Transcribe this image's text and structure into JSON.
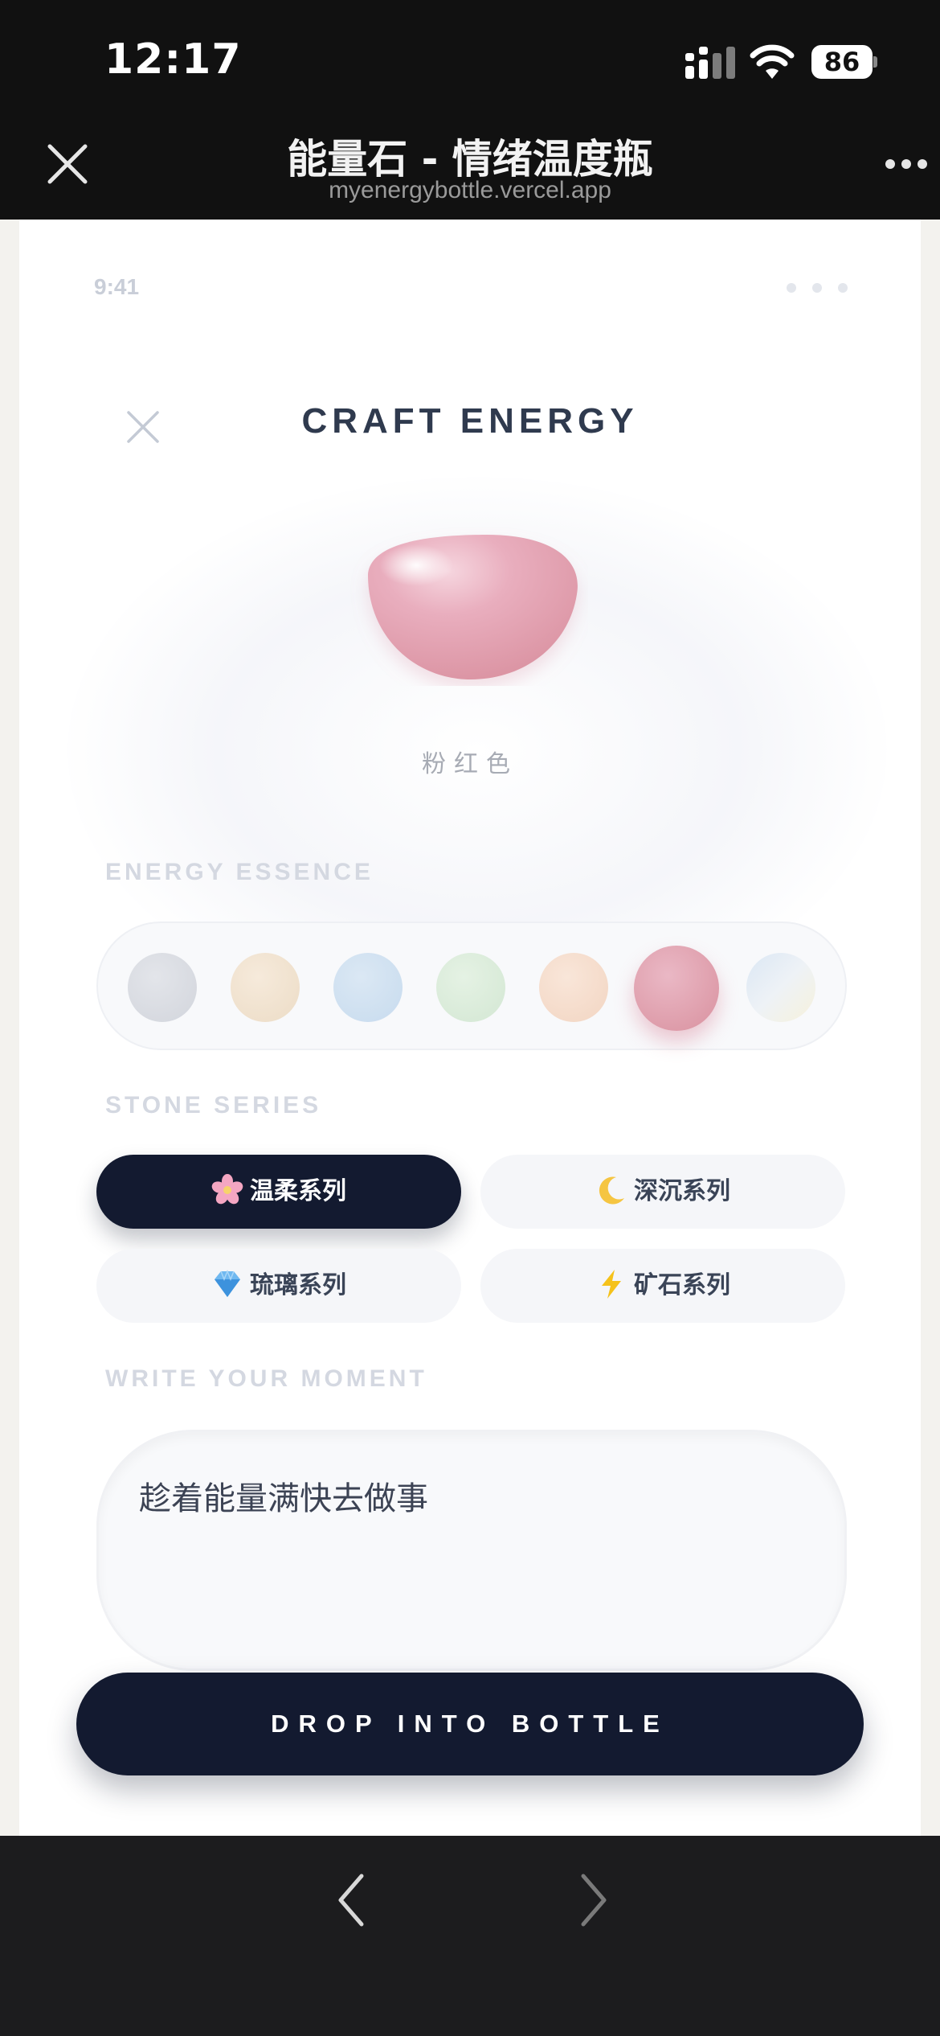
{
  "status_bar": {
    "time": "12:17",
    "battery": "86"
  },
  "browser": {
    "title": "能量石 - 情绪温度瓶",
    "url": "myenergybottle.vercel.app"
  },
  "app": {
    "time": "9:41",
    "title": "CRAFT ENERGY",
    "stone": {
      "name": "粉红色",
      "color": "#e7a9b9"
    },
    "essence_label": "ENERGY ESSENCE",
    "swatches": [
      {
        "color": "#d9dbe0"
      },
      {
        "color": "#f1e3d1"
      },
      {
        "color": "#cfe0ef"
      },
      {
        "color": "#dcecdc"
      },
      {
        "color": "#f6dccb"
      },
      {
        "color": "#e1a3b4",
        "selected": true
      },
      {
        "color": "#e6eef5"
      }
    ],
    "series_label": "STONE SERIES",
    "series": [
      {
        "label": "温柔系列",
        "icon": "cherry-blossom-icon",
        "active": true
      },
      {
        "label": "深沉系列",
        "icon": "crescent-moon-icon",
        "active": false
      },
      {
        "label": "琉璃系列",
        "icon": "gem-icon",
        "active": false
      },
      {
        "label": "矿石系列",
        "icon": "lightning-icon",
        "active": false
      }
    ],
    "moment_label": "WRITE YOUR MOMENT",
    "moment_text": "趁着能量满快去做事",
    "drop_button": "DROP INTO BOTTLE"
  },
  "colors": {
    "dark_navy": "#131a30",
    "accent_pink": "#e1a3b4"
  }
}
